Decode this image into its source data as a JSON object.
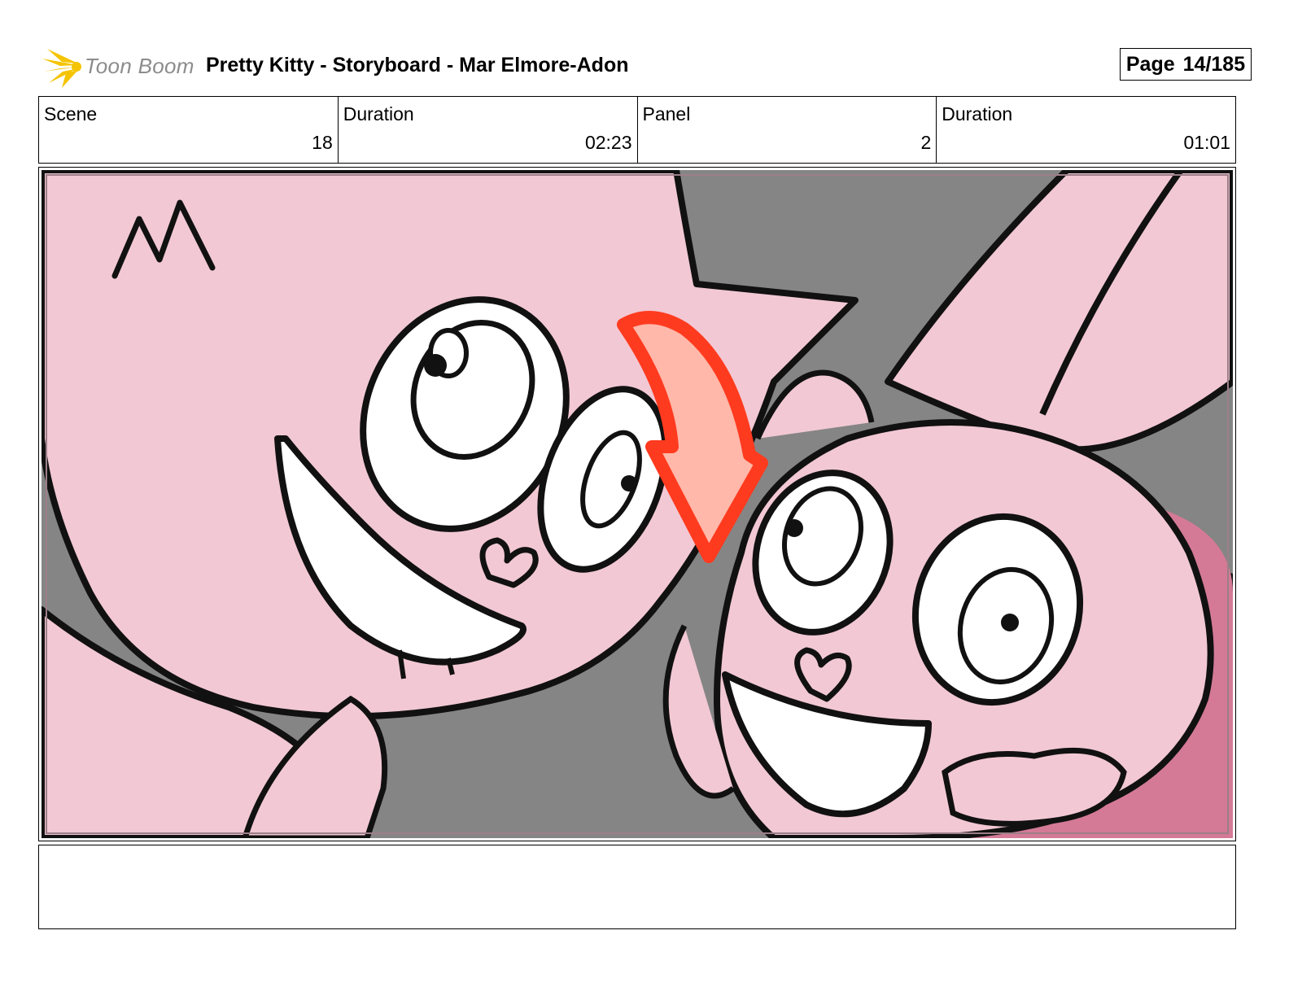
{
  "logo": {
    "text": "Toon Boom",
    "icon": "starburst-icon",
    "accent": "#f5c400"
  },
  "document": {
    "title": "Pretty Kitty - Storyboard - Mar Elmore-Adon"
  },
  "page": {
    "label": "Page",
    "number": "14/185"
  },
  "info": {
    "scene_label": "Scene",
    "scene_value": "18",
    "scene_duration_label": "Duration",
    "scene_duration_value": "02:23",
    "panel_label": "Panel",
    "panel_value": "2",
    "panel_duration_label": "Duration",
    "panel_duration_value": "01:01"
  },
  "panel_image": {
    "colors": {
      "background": "#858585",
      "skin": "#f2c8d4",
      "shadow": "#d47a97",
      "arrow": "#ff3b1f",
      "arrow_fill": "#ffb8aa"
    }
  },
  "notes": {
    "text": ""
  }
}
